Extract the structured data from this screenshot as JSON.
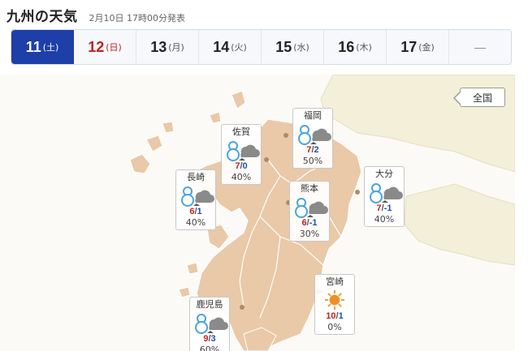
{
  "header": {
    "title": "九州の天気",
    "issued": "2月10日 17時00分発表"
  },
  "tabs": [
    {
      "day": "11",
      "dow": "(土)"
    },
    {
      "day": "12",
      "dow": "(日)"
    },
    {
      "day": "13",
      "dow": "(月)"
    },
    {
      "day": "14",
      "dow": "(火)"
    },
    {
      "day": "15",
      "dow": "(水)"
    },
    {
      "day": "16",
      "dow": "(木)"
    },
    {
      "day": "17",
      "dow": "(金)"
    },
    {
      "day": "—",
      "dow": ""
    }
  ],
  "active_tab_index": 0,
  "map": {
    "national_button": "全国",
    "colors": {
      "land": "#e9c9a8",
      "land_border": "#ffffff",
      "neighbor": "#f3efd8",
      "sea": "#fbfaf6",
      "active_tab": "#1e3fa8"
    }
  },
  "cities": [
    {
      "name": "福岡",
      "icon": "snow-cloudy-icon",
      "hi": "7",
      "lo": "2",
      "pop": "50%"
    },
    {
      "name": "佐賀",
      "icon": "snow-cloudy-icon",
      "hi": "7",
      "lo": "0",
      "pop": "40%"
    },
    {
      "name": "長崎",
      "icon": "snow-cloudy-icon",
      "hi": "6",
      "lo": "1",
      "pop": "40%"
    },
    {
      "name": "熊本",
      "icon": "snow-cloudy-icon",
      "hi": "6",
      "lo": "-1",
      "pop": "30%"
    },
    {
      "name": "大分",
      "icon": "snow-cloudy-icon",
      "hi": "7",
      "lo": "-1",
      "pop": "40%"
    },
    {
      "name": "宮崎",
      "icon": "sunny-icon",
      "hi": "10",
      "lo": "1",
      "pop": "0%"
    },
    {
      "name": "鹿児島",
      "icon": "snow-cloudy-icon",
      "hi": "9",
      "lo": "3",
      "pop": "60%"
    }
  ],
  "temp_separator": "/"
}
